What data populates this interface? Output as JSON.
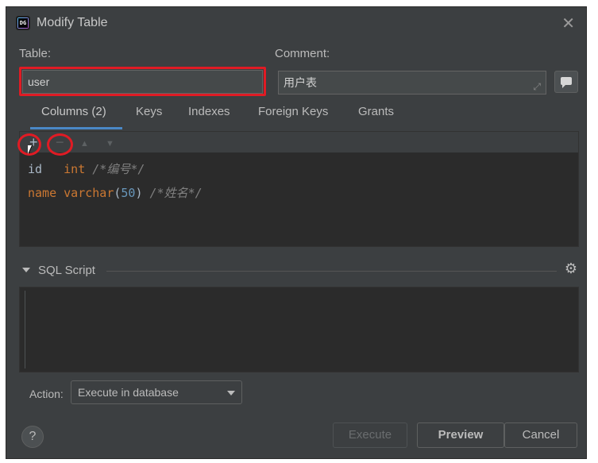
{
  "window": {
    "title": "Modify Table",
    "app_icon_label": "DG"
  },
  "form": {
    "table_label": "Table:",
    "table_value": "user",
    "comment_label": "Comment:",
    "comment_value": "用户表"
  },
  "tabs": [
    {
      "label": "Columns (2)",
      "active": true
    },
    {
      "label": "Keys",
      "active": false
    },
    {
      "label": "Indexes",
      "active": false
    },
    {
      "label": "Foreign Keys",
      "active": false
    },
    {
      "label": "Grants",
      "active": false
    }
  ],
  "toolbar": {
    "add": "+",
    "remove": "−",
    "up": "▲",
    "down": "▼"
  },
  "columns": [
    {
      "name": "id",
      "type": "int",
      "comment": "/*编号*/"
    },
    {
      "name": "name",
      "type_kw": "varchar",
      "type_open": "(",
      "type_num": "50",
      "type_close": ")",
      "comment": "/*姓名*/"
    }
  ],
  "sql_section": {
    "title": "SQL Script"
  },
  "action": {
    "label": "Action:",
    "selected": "Execute in database"
  },
  "buttons": {
    "help": "?",
    "execute": "Execute",
    "preview": "Preview",
    "cancel": "Cancel"
  },
  "icons": {
    "close": "close-icon",
    "gear": "gear-icon",
    "expand": "expand-icon",
    "comment": "comment-icon"
  },
  "colors": {
    "background": "#3c3f41",
    "editor": "#2b2b2b",
    "highlight": "#e01b24",
    "tab_underline": "#4a88c7"
  }
}
